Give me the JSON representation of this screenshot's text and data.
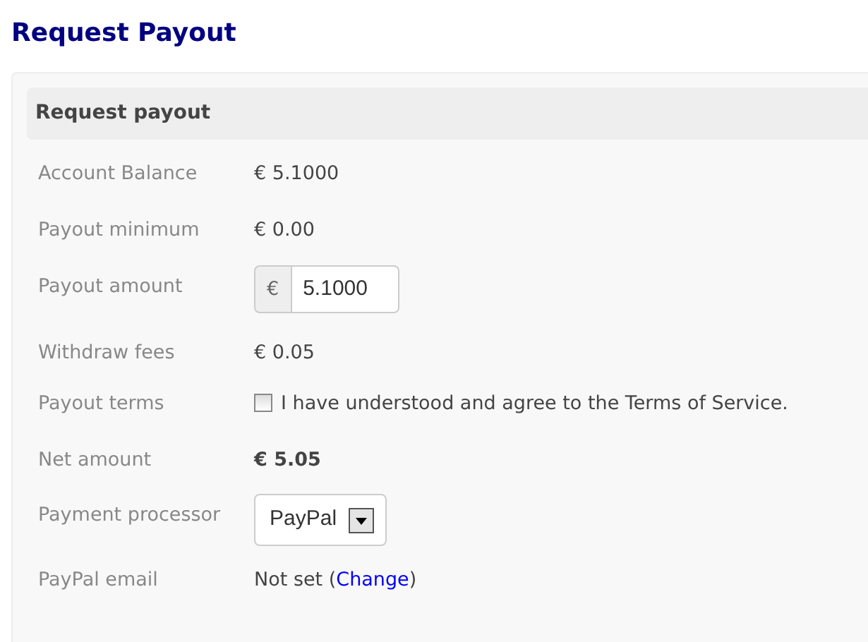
{
  "page_title": "Request Payout",
  "panel": {
    "heading": "Request payout",
    "rows": [
      {
        "kind": "text",
        "label": "Account Balance",
        "value": "€ 5.1000"
      },
      {
        "kind": "text",
        "label": "Payout minimum",
        "value": "€ 0.00"
      },
      {
        "kind": "input",
        "label": "Payout amount",
        "prefix": "€",
        "value": "5.1000"
      },
      {
        "kind": "text",
        "label": "Withdraw fees",
        "value": "€ 0.05"
      },
      {
        "kind": "checkbox",
        "label": "Payout terms",
        "text": "I have understood and agree to the Terms of Service.",
        "checked": false
      },
      {
        "kind": "bold",
        "label": "Net amount",
        "value": "€ 5.05"
      },
      {
        "kind": "select",
        "label": "Payment processor",
        "value": "PayPal"
      },
      {
        "kind": "link",
        "label": "PayPal email",
        "value": "Not set (",
        "link": "Change",
        "value_after": ")"
      }
    ]
  }
}
